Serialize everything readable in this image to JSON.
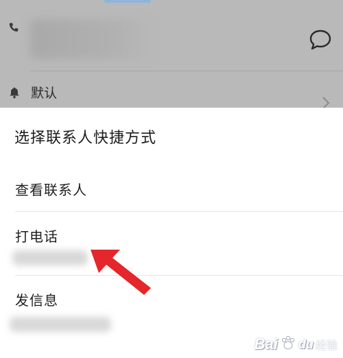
{
  "background_card": {
    "default_label": "默认"
  },
  "sheet": {
    "title": "选择联系人快捷方式",
    "options": [
      {
        "label": "查看联系人"
      },
      {
        "label": "打电话"
      },
      {
        "label": "发信息"
      }
    ]
  },
  "icons": {
    "phone": "phone-icon",
    "message": "message-bubble-icon",
    "bell": "bell-icon",
    "chevron": "chevron-right-icon"
  },
  "annotation": {
    "arrow_color": "#e5262b"
  },
  "watermark": {
    "text": "Bai",
    "paw": "du",
    "sub": "经验"
  }
}
